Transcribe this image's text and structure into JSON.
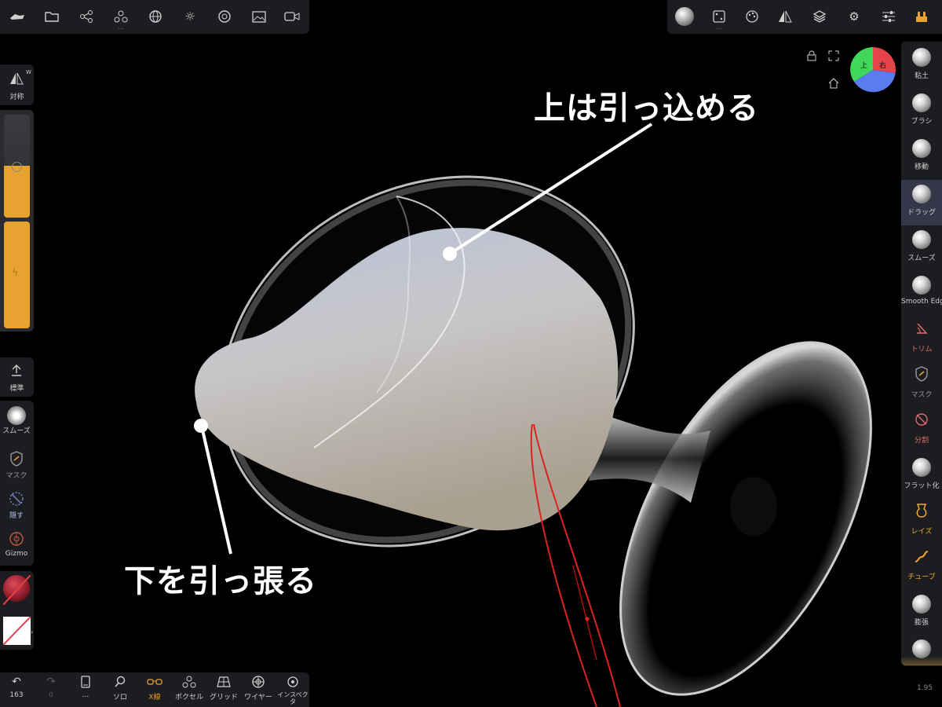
{
  "top_left_toolbar": {
    "buttons": [
      {
        "icon": "ship-icon"
      },
      {
        "icon": "folder-icon"
      },
      {
        "icon": "share-nodes-icon"
      },
      {
        "icon": "spheres-icon"
      },
      {
        "icon": "grid-sphere-icon"
      },
      {
        "icon": "sun-icon"
      },
      {
        "icon": "aperture-icon"
      },
      {
        "icon": "image-icon"
      },
      {
        "icon": "video-icon"
      }
    ]
  },
  "top_right_toolbar": {
    "buttons": [
      {
        "icon": "material-ball-icon"
      },
      {
        "icon": "dice-icon"
      },
      {
        "icon": "palette-icon"
      },
      {
        "icon": "symmetry-triangle-icon"
      },
      {
        "icon": "layers-icon"
      },
      {
        "icon": "gear-icon"
      },
      {
        "icon": "sliders-icon"
      },
      {
        "icon": "scene-icon"
      }
    ]
  },
  "viewport_controls": {
    "axis_up_label": "上",
    "axis_right_label": "右"
  },
  "right_tools": [
    {
      "label": "粘土",
      "kind": "ball"
    },
    {
      "label": "ブラシ",
      "kind": "ball"
    },
    {
      "label": "移動",
      "kind": "ball"
    },
    {
      "label": "ドラッグ",
      "kind": "ball",
      "active": true
    },
    {
      "label": "スムーズ",
      "kind": "ball"
    },
    {
      "label": "Smooth Edge",
      "kind": "ball"
    },
    {
      "label": "トリム",
      "kind": "icon",
      "icon": "trim-icon",
      "color": "#e06a6a"
    },
    {
      "label": "マスク",
      "kind": "icon",
      "icon": "mask-shield-icon",
      "color": "#9a9a9a"
    },
    {
      "label": "分割",
      "kind": "icon",
      "icon": "split-icon",
      "color": "#e06a6a"
    },
    {
      "label": "フラット化",
      "kind": "ball"
    },
    {
      "label": "レイズ",
      "kind": "icon",
      "icon": "raise-icon",
      "color": "#f0a830"
    },
    {
      "label": "チューブ",
      "kind": "icon",
      "icon": "tube-icon",
      "color": "#f0a830"
    },
    {
      "label": "膨張",
      "kind": "ball"
    }
  ],
  "left_panel": {
    "symmetry_label": "対称",
    "symmetry_badge": "W",
    "standard_label": "標準",
    "smooth_label": "スムーズ",
    "mask_label": "マスク",
    "hide_label": "隠す",
    "gizmo_label": "Gizmo",
    "accent_color": "#e8a230"
  },
  "bottom_toolbar": {
    "undo_count": "163",
    "redo_count": "0",
    "items": [
      {
        "label": "...",
        "icon": "book-icon"
      },
      {
        "label": "ソロ",
        "icon": "magnifier-icon"
      },
      {
        "label": "X線",
        "icon": "glasses-icon",
        "highlight": true
      },
      {
        "label": "ボクセル",
        "icon": "voxel-icon"
      },
      {
        "label": "グリッド",
        "icon": "grid-icon"
      },
      {
        "label": "ワイヤー",
        "icon": "wire-icon"
      },
      {
        "label": "インスペクタ",
        "icon": "inspector-icon"
      }
    ]
  },
  "version": "1.95",
  "annotations": {
    "top": "上は引っ込める",
    "bottom": "下を引っ張る"
  }
}
